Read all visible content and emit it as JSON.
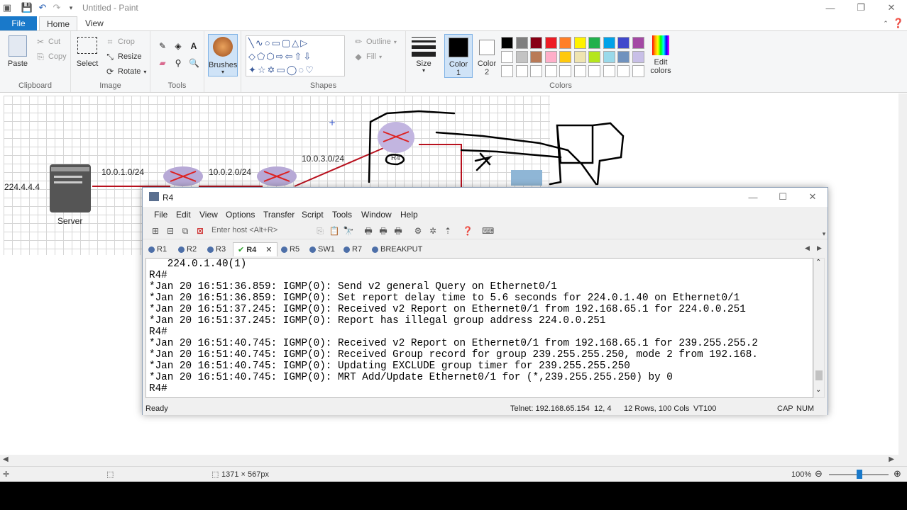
{
  "paint": {
    "title": "Untitled - Paint",
    "tabs": [
      "File",
      "Home",
      "View"
    ],
    "clipboard": {
      "paste": "Paste",
      "cut": "Cut",
      "copy": "Copy",
      "label": "Clipboard"
    },
    "image": {
      "select": "Select",
      "crop": "Crop",
      "resize": "Resize",
      "rotate": "Rotate",
      "label": "Image"
    },
    "tools": {
      "label": "Tools"
    },
    "brushes": {
      "label": "Brushes"
    },
    "shapes": {
      "outline": "Outline",
      "fill": "Fill",
      "label": "Shapes"
    },
    "size": {
      "label": "Size"
    },
    "color1": {
      "label": "Color",
      "num": "1"
    },
    "color2": {
      "label": "Color",
      "num": "2"
    },
    "edit_colors": {
      "line1": "Edit",
      "line2": "colors"
    },
    "colors_label": "Colors",
    "palette_row1": [
      "#000000",
      "#7f7f7f",
      "#880015",
      "#ed1c24",
      "#ff7f27",
      "#fff200",
      "#22b14c",
      "#00a2e8",
      "#3f48cc",
      "#a349a4"
    ],
    "palette_row2": [
      "#ffffff",
      "#c3c3c3",
      "#b97a57",
      "#ffaec9",
      "#ffc90e",
      "#efe4b0",
      "#b5e61d",
      "#99d9ea",
      "#7092be",
      "#c8bfe7"
    ],
    "status": {
      "dimensions": "1371 × 567px",
      "zoom": "100%"
    }
  },
  "diagram": {
    "server_ip": "224.4.4.4",
    "server_label": "Server",
    "net1": "10.0.1.0/24",
    "net2": "10.0.2.0/24",
    "net3": "10.0.3.0/24",
    "r4_label": "R4"
  },
  "crt": {
    "title": "R4",
    "menu": [
      "File",
      "Edit",
      "View",
      "Options",
      "Transfer",
      "Script",
      "Tools",
      "Window",
      "Help"
    ],
    "host_placeholder": "Enter host <Alt+R>",
    "tabs": [
      "R1",
      "R2",
      "R3",
      "R4",
      "R5",
      "SW1",
      "R7",
      "BREAKPUT"
    ],
    "lines": [
      "   224.0.1.40(1)",
      "R4#",
      "*Jan 20 16:51:36.859: IGMP(0): Send v2 general Query on Ethernet0/1",
      "*Jan 20 16:51:36.859: IGMP(0): Set report delay time to 5.6 seconds for 224.0.1.40 on Ethernet0/1",
      "*Jan 20 16:51:37.245: IGMP(0): Received v2 Report on Ethernet0/1 from 192.168.65.1 for 224.0.0.251",
      "*Jan 20 16:51:37.245: IGMP(0): Report has illegal group address 224.0.0.251",
      "R4#",
      "*Jan 20 16:51:40.745: IGMP(0): Received v2 Report on Ethernet0/1 from 192.168.65.1 for 239.255.255.2",
      "*Jan 20 16:51:40.745: IGMP(0): Received Group record for group 239.255.255.250, mode 2 from 192.168.",
      "*Jan 20 16:51:40.745: IGMP(0): Updating EXCLUDE group timer for 239.255.255.250",
      "*Jan 20 16:51:40.745: IGMP(0): MRT Add/Update Ethernet0/1 for (*,239.255.255.250) by 0",
      "R4#"
    ],
    "status": {
      "ready": "Ready",
      "telnet": "Telnet: 192.168.65.154",
      "cursor": "12,  4",
      "size": "12 Rows, 100 Cols",
      "term": "VT100",
      "cap": "CAP",
      "num": "NUM"
    }
  }
}
